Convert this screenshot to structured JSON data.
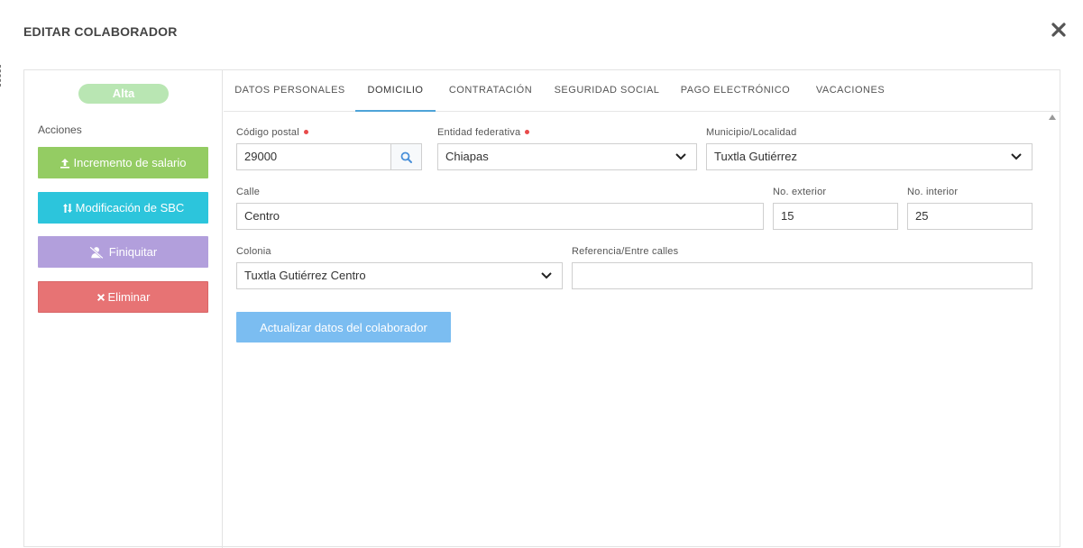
{
  "modal": {
    "title": "EDITAR COLABORADOR"
  },
  "left_panel": {
    "status": "Alta",
    "actions_label": "Acciones",
    "buttons": {
      "increment_salary": "Incremento de salario",
      "modify_sbc": "Modificación de SBC",
      "finiquitar": "Finiquitar",
      "delete": "Eliminar"
    }
  },
  "tabs": [
    {
      "label": "DATOS PERSONALES",
      "active": false
    },
    {
      "label": "DOMICILIO",
      "active": true
    },
    {
      "label": "CONTRATACIÓN",
      "active": false
    },
    {
      "label": "SEGURIDAD SOCIAL",
      "active": false
    },
    {
      "label": "PAGO ELECTRÓNICO",
      "active": false
    },
    {
      "label": "VACACIONES",
      "active": false
    }
  ],
  "form": {
    "postal_code": {
      "label": "Código postal",
      "value": "29000",
      "required": true
    },
    "state": {
      "label": "Entidad federativa",
      "value": "Chiapas",
      "required": true
    },
    "municipality": {
      "label": "Municipio/Localidad",
      "value": "Tuxtla Gutiérrez"
    },
    "street": {
      "label": "Calle",
      "value": "Centro"
    },
    "ext_number": {
      "label": "No. exterior",
      "value": "15"
    },
    "int_number": {
      "label": "No. interior",
      "value": "25"
    },
    "neighborhood": {
      "label": "Colonia",
      "value": "Tuxtla Gutiérrez Centro"
    },
    "reference": {
      "label": "Referencia/Entre calles",
      "value": ""
    },
    "submit_label": "Actualizar datos del colaborador"
  },
  "colors": {
    "increment": "#94cc63",
    "modify": "#2cc5dc",
    "finiquitar": "#b29fdc",
    "delete": "#e77374",
    "submit": "#7bbdf1",
    "status_pill": "#b9e6b3",
    "tab_active_underline": "#4ea3d8",
    "required_dot": "#e84b4b"
  },
  "icons": {
    "close": "close-icon",
    "increment": "upload-icon",
    "modify": "sort-arrows-icon",
    "finiquitar": "user-slash-icon",
    "delete": "times-icon",
    "search": "search-icon",
    "select": "chevron-down-icon"
  }
}
